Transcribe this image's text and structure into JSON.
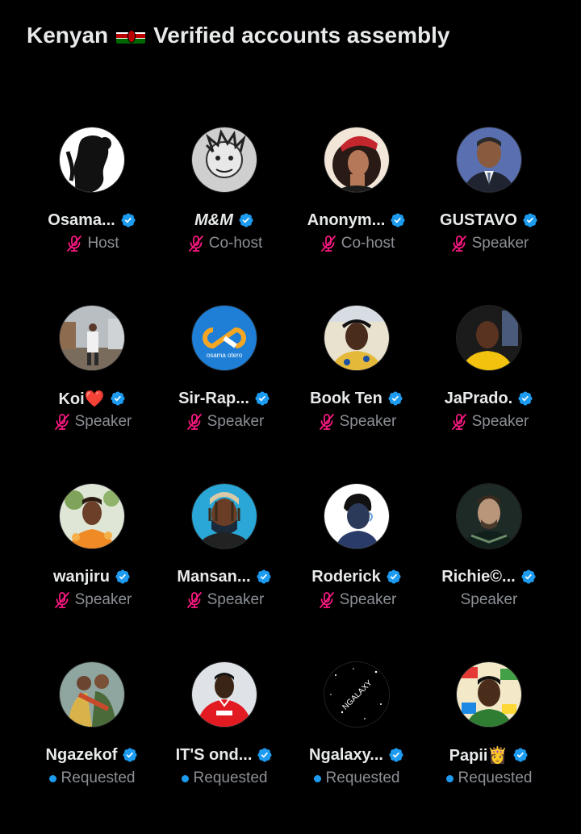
{
  "space": {
    "title_before_flag": "Kenyan",
    "flag_icon": "kenya-flag-icon",
    "title_after_flag": "Verified accounts assembly"
  },
  "colors": {
    "background": "#000000",
    "name": "#e7e9ea",
    "role": "#8b8f94",
    "verified": "#1d9bf0",
    "muted_mic": "#f91880",
    "requested_dot": "#1d9bf0"
  },
  "participants": [
    {
      "name": "Osama...",
      "role": "Host",
      "muted": true,
      "requested": false,
      "avatar": "avatar-silhouette-icon"
    },
    {
      "name": "M&M",
      "role": "Co-host",
      "muted": true,
      "requested": false,
      "avatar": "avatar-sketch-icon"
    },
    {
      "name": "Anonym...",
      "role": "Co-host",
      "muted": true,
      "requested": false,
      "avatar": "avatar-illustrated-woman-icon"
    },
    {
      "name": "GUSTAVO",
      "role": "Speaker",
      "muted": true,
      "requested": false,
      "avatar": "avatar-man-suit-icon"
    },
    {
      "name": "Koi❤️",
      "role": "Speaker",
      "muted": true,
      "requested": false,
      "avatar": "avatar-street-photo-icon"
    },
    {
      "name": "Sir-Rap...",
      "role": "Speaker",
      "muted": true,
      "requested": false,
      "avatar": "avatar-logo-icon",
      "avatar_text": "osama otero"
    },
    {
      "name": "Book Ten",
      "role": "Speaker",
      "muted": true,
      "requested": false,
      "avatar": "avatar-man-cap-icon"
    },
    {
      "name": "JaPrado.",
      "role": "Speaker",
      "muted": true,
      "requested": false,
      "avatar": "avatar-man-yellow-shirt-icon"
    },
    {
      "name": "wanjiru",
      "role": "Speaker",
      "muted": true,
      "requested": false,
      "avatar": "avatar-woman-flowers-icon"
    },
    {
      "name": "Mansan...",
      "role": "Speaker",
      "muted": true,
      "requested": false,
      "avatar": "avatar-masked-man-icon"
    },
    {
      "name": "Roderick",
      "role": "Speaker",
      "muted": true,
      "requested": false,
      "avatar": "avatar-illustrated-boy-icon"
    },
    {
      "name": "Richie©...",
      "role": "Speaker",
      "muted": false,
      "requested": false,
      "avatar": "avatar-dark-portrait-icon"
    },
    {
      "name": "Ngazekof",
      "role": "Requested",
      "muted": false,
      "requested": true,
      "avatar": "avatar-group-photo-icon"
    },
    {
      "name": "IT'S ond...",
      "role": "Requested",
      "muted": false,
      "requested": true,
      "avatar": "avatar-football-shirt-icon"
    },
    {
      "name": "Ngalaxy...",
      "role": "Requested",
      "muted": false,
      "requested": true,
      "avatar": "avatar-galaxy-logo-icon",
      "avatar_text": "NGALAXY"
    },
    {
      "name": "Papii👸",
      "role": "Requested",
      "muted": false,
      "requested": true,
      "avatar": "avatar-sticker-collage-icon"
    }
  ]
}
